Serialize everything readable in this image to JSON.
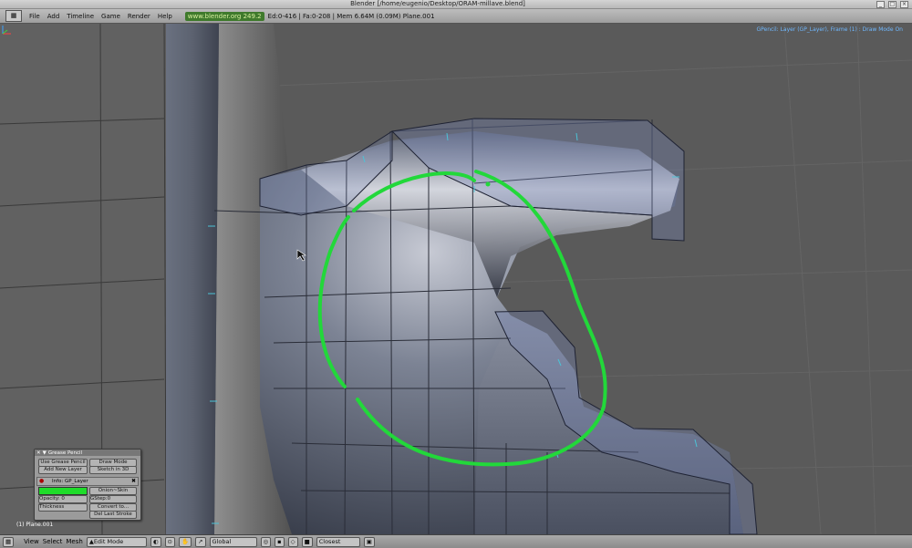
{
  "window": {
    "title": "Blender [/home/eugenio/Desktop/ORAM-millave.blend]",
    "controls": [
      "_",
      "□",
      "×"
    ]
  },
  "menubar": {
    "window_type_icon": "grid-icon",
    "items": [
      "File",
      "Add",
      "Timeline",
      "Game",
      "Render",
      "Help"
    ],
    "url": "www.blender.org 249.2",
    "stats": "Ed:0-416 | Fa:0-208 | Mem 6.64M (0.09M) Plane.001"
  },
  "viewport": {
    "overlay": "GPencil: Layer (GP_Layer), Frame (1) : Draw Mode On",
    "object_label": "(1) Plane.001",
    "stroke_color": "#22d83a",
    "background_color": "#5a5a5a"
  },
  "grease_pencil_panel": {
    "title": "Grease Pencil",
    "use_grease_pencil": "Use Grease Pencil",
    "draw_mode": "Draw Mode",
    "add_new_layer": "Add New Layer",
    "sketch_in_3d": "Sketch in 3D",
    "layer_name": "Info: GP_Layer",
    "layer_color": "#1fdc2a",
    "onion_skin": "Onion~Skin",
    "opacity": "Opacity: 0",
    "gstep": "GStep:0",
    "thickness": "Thickness",
    "convert_to": "Convert to...",
    "del_last_stroke": "Del Last Stroke"
  },
  "statusbar": {
    "menus": [
      "View",
      "Select",
      "Mesh"
    ],
    "mode": "Edit Mode",
    "orientation": "Global",
    "snap": "Closest"
  }
}
